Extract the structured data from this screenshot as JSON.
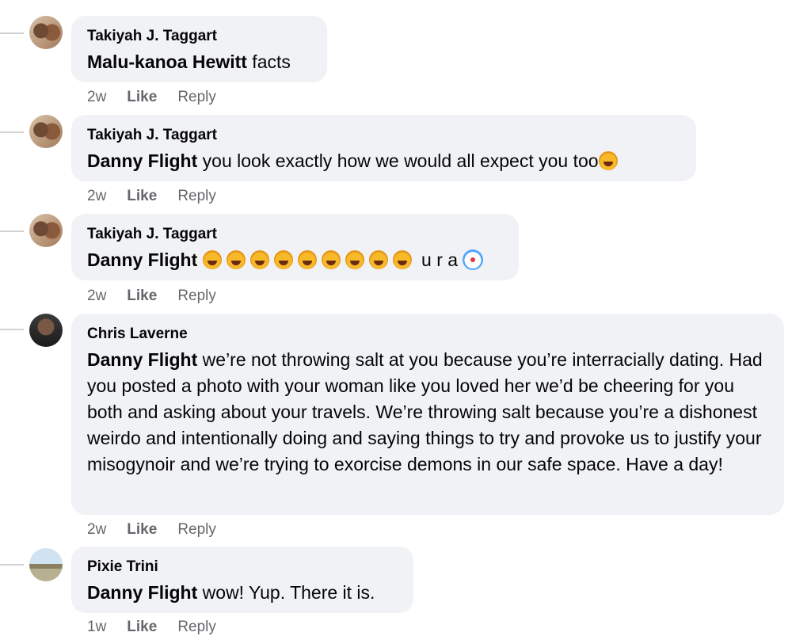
{
  "comments": [
    {
      "author": "Takiyah J. Taggart",
      "mention": "Malu-kanoa Hewitt",
      "text": " facts",
      "time": "2w",
      "like": "Like",
      "reply": "Reply"
    },
    {
      "author": "Takiyah J. Taggart",
      "mention": "Danny Flight",
      "text": " you look exactly how we would all expect you too",
      "time": "2w",
      "like": "Like",
      "reply": "Reply"
    },
    {
      "author": "Takiyah J. Taggart",
      "mention": "Danny Flight",
      "text": " u r a",
      "time": "2w",
      "like": "Like",
      "reply": "Reply"
    },
    {
      "author": "Chris Laverne",
      "mention": "Danny Flight",
      "text": " we’re not throwing salt at you because you’re interracially dating. Had you posted a photo with your woman like you loved her we’d be cheering for you both and asking about your travels. We’re throwing salt because you’re a dishonest weirdo and intentionally doing and saying things to try and provoke us to justify your misogynoir and we’re trying to exorcise demons in our safe space. Have a day!",
      "time": "2w",
      "like": "Like",
      "reply": "Reply"
    },
    {
      "author": "Pixie Trini",
      "mention": "Danny Flight",
      "text": " wow! Yup. There it is.",
      "time": "1w",
      "like": "Like",
      "reply": "Reply"
    }
  ],
  "icons": {
    "laugh": "rolling-on-floor-laughing-icon",
    "clown": "clown-face-icon"
  }
}
